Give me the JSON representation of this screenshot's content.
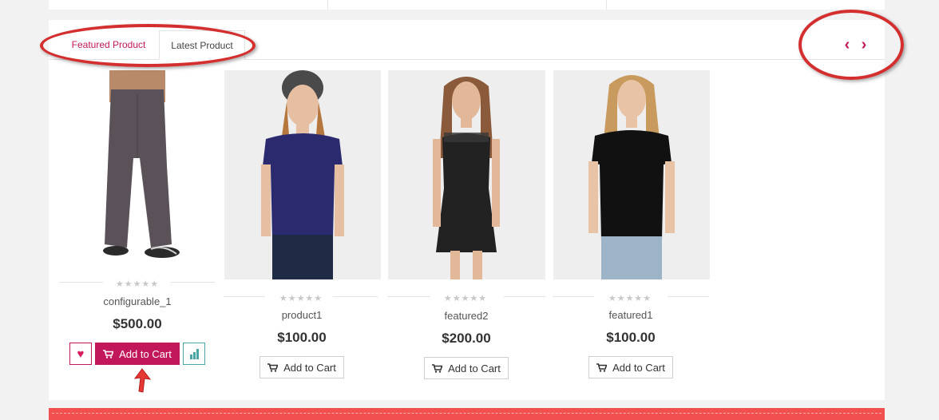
{
  "tabs": {
    "featured_label": "Featured Product",
    "latest_label": "Latest Product"
  },
  "nav": {
    "prev_glyph": "‹",
    "next_glyph": "›"
  },
  "rating_glyphs": "★★★★★",
  "colors": {
    "accent": "#c2185b",
    "annotation": "#d32f2f",
    "compare": "#4aa6a6",
    "footer": "#f1504e"
  },
  "products": [
    {
      "name": "configurable_1",
      "price": "$500.00",
      "cart_label": "Add to Cart",
      "rating": 0
    },
    {
      "name": "product1",
      "price": "$100.00",
      "cart_label": "Add to Cart",
      "rating": 0
    },
    {
      "name": "featured2",
      "price": "$200.00",
      "cart_label": "Add to Cart",
      "rating": 0
    },
    {
      "name": "featured1",
      "price": "$100.00",
      "cart_label": "Add to Cart",
      "rating": 0
    }
  ]
}
